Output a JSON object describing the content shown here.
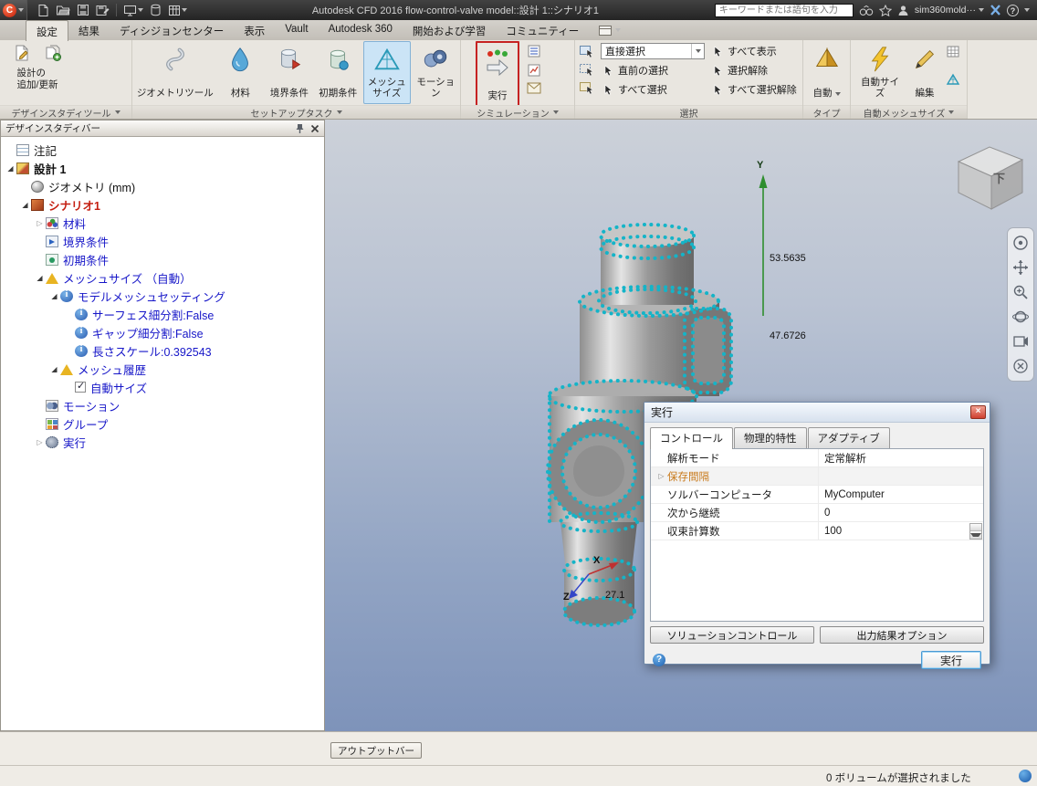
{
  "icons": {
    "app-logo": "red circle C",
    "search": "binoculars",
    "favorites": "star",
    "user": "person silhouette",
    "exchange": "blue X",
    "help": "question mark circle",
    "pin": "push pin",
    "close": "×",
    "dropdown": "▼",
    "expander_collapsed": "▷",
    "expander_expanded": "◢",
    "checkbox_check": "✓"
  },
  "titlebar": {
    "logo_letter": "C",
    "title": "Autodesk CFD 2016   flow-control-valve model::設計 1::シナリオ1",
    "search_placeholder": "キーワードまたは語句を入力",
    "username": "sim360mold···"
  },
  "menubar": {
    "tabs": [
      {
        "label": "設定",
        "name": "settings",
        "active": true
      },
      {
        "label": "結果",
        "name": "results"
      },
      {
        "label": "ディシジョンセンター",
        "name": "decision-center"
      },
      {
        "label": "表示",
        "name": "view"
      },
      {
        "label": "Vault",
        "name": "vault"
      },
      {
        "label": "Autodesk 360",
        "name": "autodesk-360"
      },
      {
        "label": "開始および学習",
        "name": "getting-started"
      },
      {
        "label": "コミュニティー",
        "name": "community"
      }
    ]
  },
  "ribbon": {
    "design_study": {
      "group_label": "デザインスタディツール",
      "button_line1": "設計の",
      "button_line2": "追加/更新"
    },
    "setup": {
      "group_label": "セットアップタスク",
      "items": [
        {
          "name": "geometry-tools-button",
          "icon": "geometry",
          "lines": [
            "ジオメトリツール"
          ],
          "wide": true
        },
        {
          "name": "materials-button",
          "icon": "drop",
          "lines": [
            "材料"
          ]
        },
        {
          "name": "boundary-conditions-button",
          "icon": "cylinderArrow",
          "lines": [
            "境界条件"
          ]
        },
        {
          "name": "initial-conditions-button",
          "icon": "cylinder",
          "lines": [
            "初期条件"
          ]
        },
        {
          "name": "mesh-size-button",
          "icon": "mesh",
          "lines": [
            "メッシュ",
            "サイズ"
          ],
          "selected": true
        },
        {
          "name": "motion-button",
          "icon": "motion",
          "lines": [
            "モーション"
          ]
        }
      ]
    },
    "simulation": {
      "group_label": "シミュレーション",
      "run_label": "実行"
    },
    "selection": {
      "group_label": "選択",
      "dropdown_label": "直接選択",
      "col1": [
        {
          "name": "previous-selection-button",
          "label": "直前の選択"
        },
        {
          "name": "select-all-button",
          "label": "すべて選択"
        }
      ],
      "col2": [
        {
          "name": "show-all-button",
          "label": "すべて表示"
        },
        {
          "name": "deselect-button",
          "label": "選択解除"
        },
        {
          "name": "deselect-all-button",
          "label": "すべて選択解除"
        }
      ]
    },
    "type": {
      "group_label": "タイプ",
      "auto_label": "自動"
    },
    "auto_mesh": {
      "group_label": "自動メッシュサイズ",
      "autosize_label": "自動サイズ",
      "edit_label": "編集"
    }
  },
  "design_study_bar": {
    "title": "デザインスタディバー",
    "tree": [
      {
        "label": "注記",
        "level": 0,
        "icon": "note",
        "color": "black"
      },
      {
        "label": "設計 1",
        "level": 0,
        "icon": "design",
        "color": "black",
        "bold": true,
        "expander": "expanded"
      },
      {
        "label": "ジオメトリ (mm)",
        "level": 1,
        "icon": "geometry",
        "color": "black"
      },
      {
        "label": "シナリオ1",
        "level": 1,
        "icon": "scenario",
        "color": "red",
        "expander": "expanded"
      },
      {
        "label": "材料",
        "level": 2,
        "icon": "material",
        "color": "blue",
        "expander": "collapsed"
      },
      {
        "label": "境界条件",
        "level": 2,
        "icon": "boundary",
        "color": "blue"
      },
      {
        "label": "初期条件",
        "level": 2,
        "icon": "initial",
        "color": "blue"
      },
      {
        "label": "メッシュサイズ （自動）",
        "level": 2,
        "icon": "mesh",
        "color": "blue",
        "expander": "expanded"
      },
      {
        "label": "モデルメッシュセッティング",
        "level": 3,
        "icon": "info",
        "color": "blue",
        "expander": "expanded"
      },
      {
        "label": "サーフェス細分割:False",
        "level": 4,
        "icon": "info",
        "color": "blue"
      },
      {
        "label": "ギャップ細分割:False",
        "level": 4,
        "icon": "info",
        "color": "blue"
      },
      {
        "label": "長さスケール:0.392543",
        "level": 4,
        "icon": "info",
        "color": "blue"
      },
      {
        "label": "メッシュ履歴",
        "level": 3,
        "icon": "mesh",
        "color": "blue",
        "expander": "expanded"
      },
      {
        "label": "自動サイズ",
        "level": 4,
        "checkbox": true,
        "checked": true,
        "color": "blue"
      },
      {
        "label": "モーション",
        "level": 2,
        "icon": "motion",
        "color": "blue"
      },
      {
        "label": "グループ",
        "level": 2,
        "icon": "group",
        "color": "blue"
      },
      {
        "label": "実行",
        "level": 2,
        "icon": "run",
        "color": "blue",
        "expander": "collapsed"
      }
    ]
  },
  "viewport": {
    "axis_y_label": "Y",
    "axis_x_label": "X",
    "axis_z_label": "Z",
    "dim_1": "53.5635",
    "dim_2": "47.6726",
    "dim_3": "27.1",
    "viewcube_face": "下"
  },
  "run_dialog": {
    "title": "実行",
    "tabs": [
      {
        "label": "コントロール",
        "active": true
      },
      {
        "label": "物理的特性"
      },
      {
        "label": "アダプティブ"
      }
    ],
    "rows": [
      {
        "label": "解析モード",
        "value": "定常解析"
      },
      {
        "label": "保存間隔",
        "value": "",
        "orange": true,
        "expander": true,
        "shaded": true
      },
      {
        "label": "ソルバーコンピュータ",
        "value": "MyComputer"
      },
      {
        "label": "次から継続",
        "value": "0"
      },
      {
        "label": "収束計算数",
        "value": "100",
        "spinner": true
      }
    ],
    "buttons": [
      {
        "name": "solution-control-button",
        "label": "ソリューションコントロール"
      },
      {
        "name": "output-options-button",
        "label": "出力結果オプション"
      }
    ],
    "run_button_label": "実行"
  },
  "output_bar": {
    "label": "アウトプットバー"
  },
  "statusbar": {
    "text": "0 ボリュームが選択されました"
  }
}
